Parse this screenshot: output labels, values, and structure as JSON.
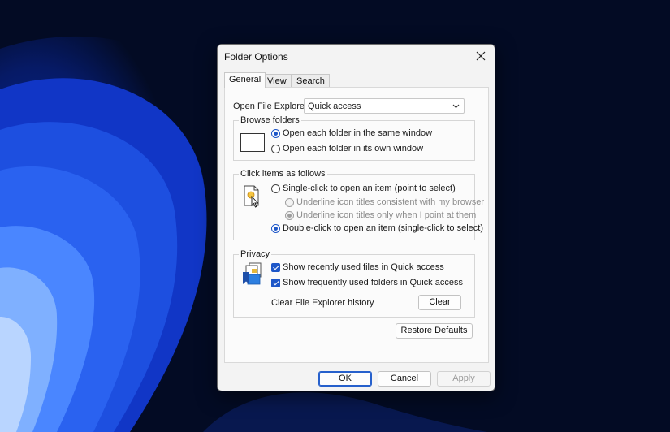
{
  "window": {
    "title": "Folder Options"
  },
  "tabs": [
    {
      "label": "General",
      "active": true
    },
    {
      "label": "View",
      "active": false
    },
    {
      "label": "Search",
      "active": false
    }
  ],
  "general": {
    "open_explorer_label": "Open File Explorer to:",
    "open_explorer_value": "Quick access",
    "browse_folders": {
      "legend": "Browse folders",
      "options": [
        {
          "label": "Open each folder in the same window",
          "selected": true
        },
        {
          "label": "Open each folder in its own window",
          "selected": false
        }
      ]
    },
    "click_items": {
      "legend": "Click items as follows",
      "single_click": {
        "label": "Single-click to open an item (point to select)",
        "selected": false
      },
      "sub_options": [
        {
          "label": "Underline icon titles consistent with my browser",
          "selected": false,
          "disabled": true
        },
        {
          "label": "Underline icon titles only when I point at them",
          "selected": true,
          "disabled": true
        }
      ],
      "double_click": {
        "label": "Double-click to open an item (single-click to select)",
        "selected": true
      }
    },
    "privacy": {
      "legend": "Privacy",
      "checkboxes": [
        {
          "label": "Show recently used files in Quick access",
          "checked": true
        },
        {
          "label": "Show frequently used folders in Quick access",
          "checked": true
        }
      ],
      "clear_history_label": "Clear File Explorer history",
      "clear_button": "Clear"
    },
    "restore_defaults_button": "Restore Defaults"
  },
  "footer": {
    "ok": "OK",
    "cancel": "Cancel",
    "apply": "Apply"
  },
  "colors": {
    "accent": "#1e57c8",
    "dialog_bg": "#f3f3f3",
    "panel_bg": "#fbfbfb",
    "wallpaper_dark": "#030b24",
    "wallpaper_blue": "#1d4fe0"
  },
  "icons": {
    "close": "close-icon",
    "dropdown": "chevron-down-icon",
    "browse": "window-frame-icon",
    "click": "document-cursor-icon",
    "privacy": "privacy-files-icon"
  }
}
